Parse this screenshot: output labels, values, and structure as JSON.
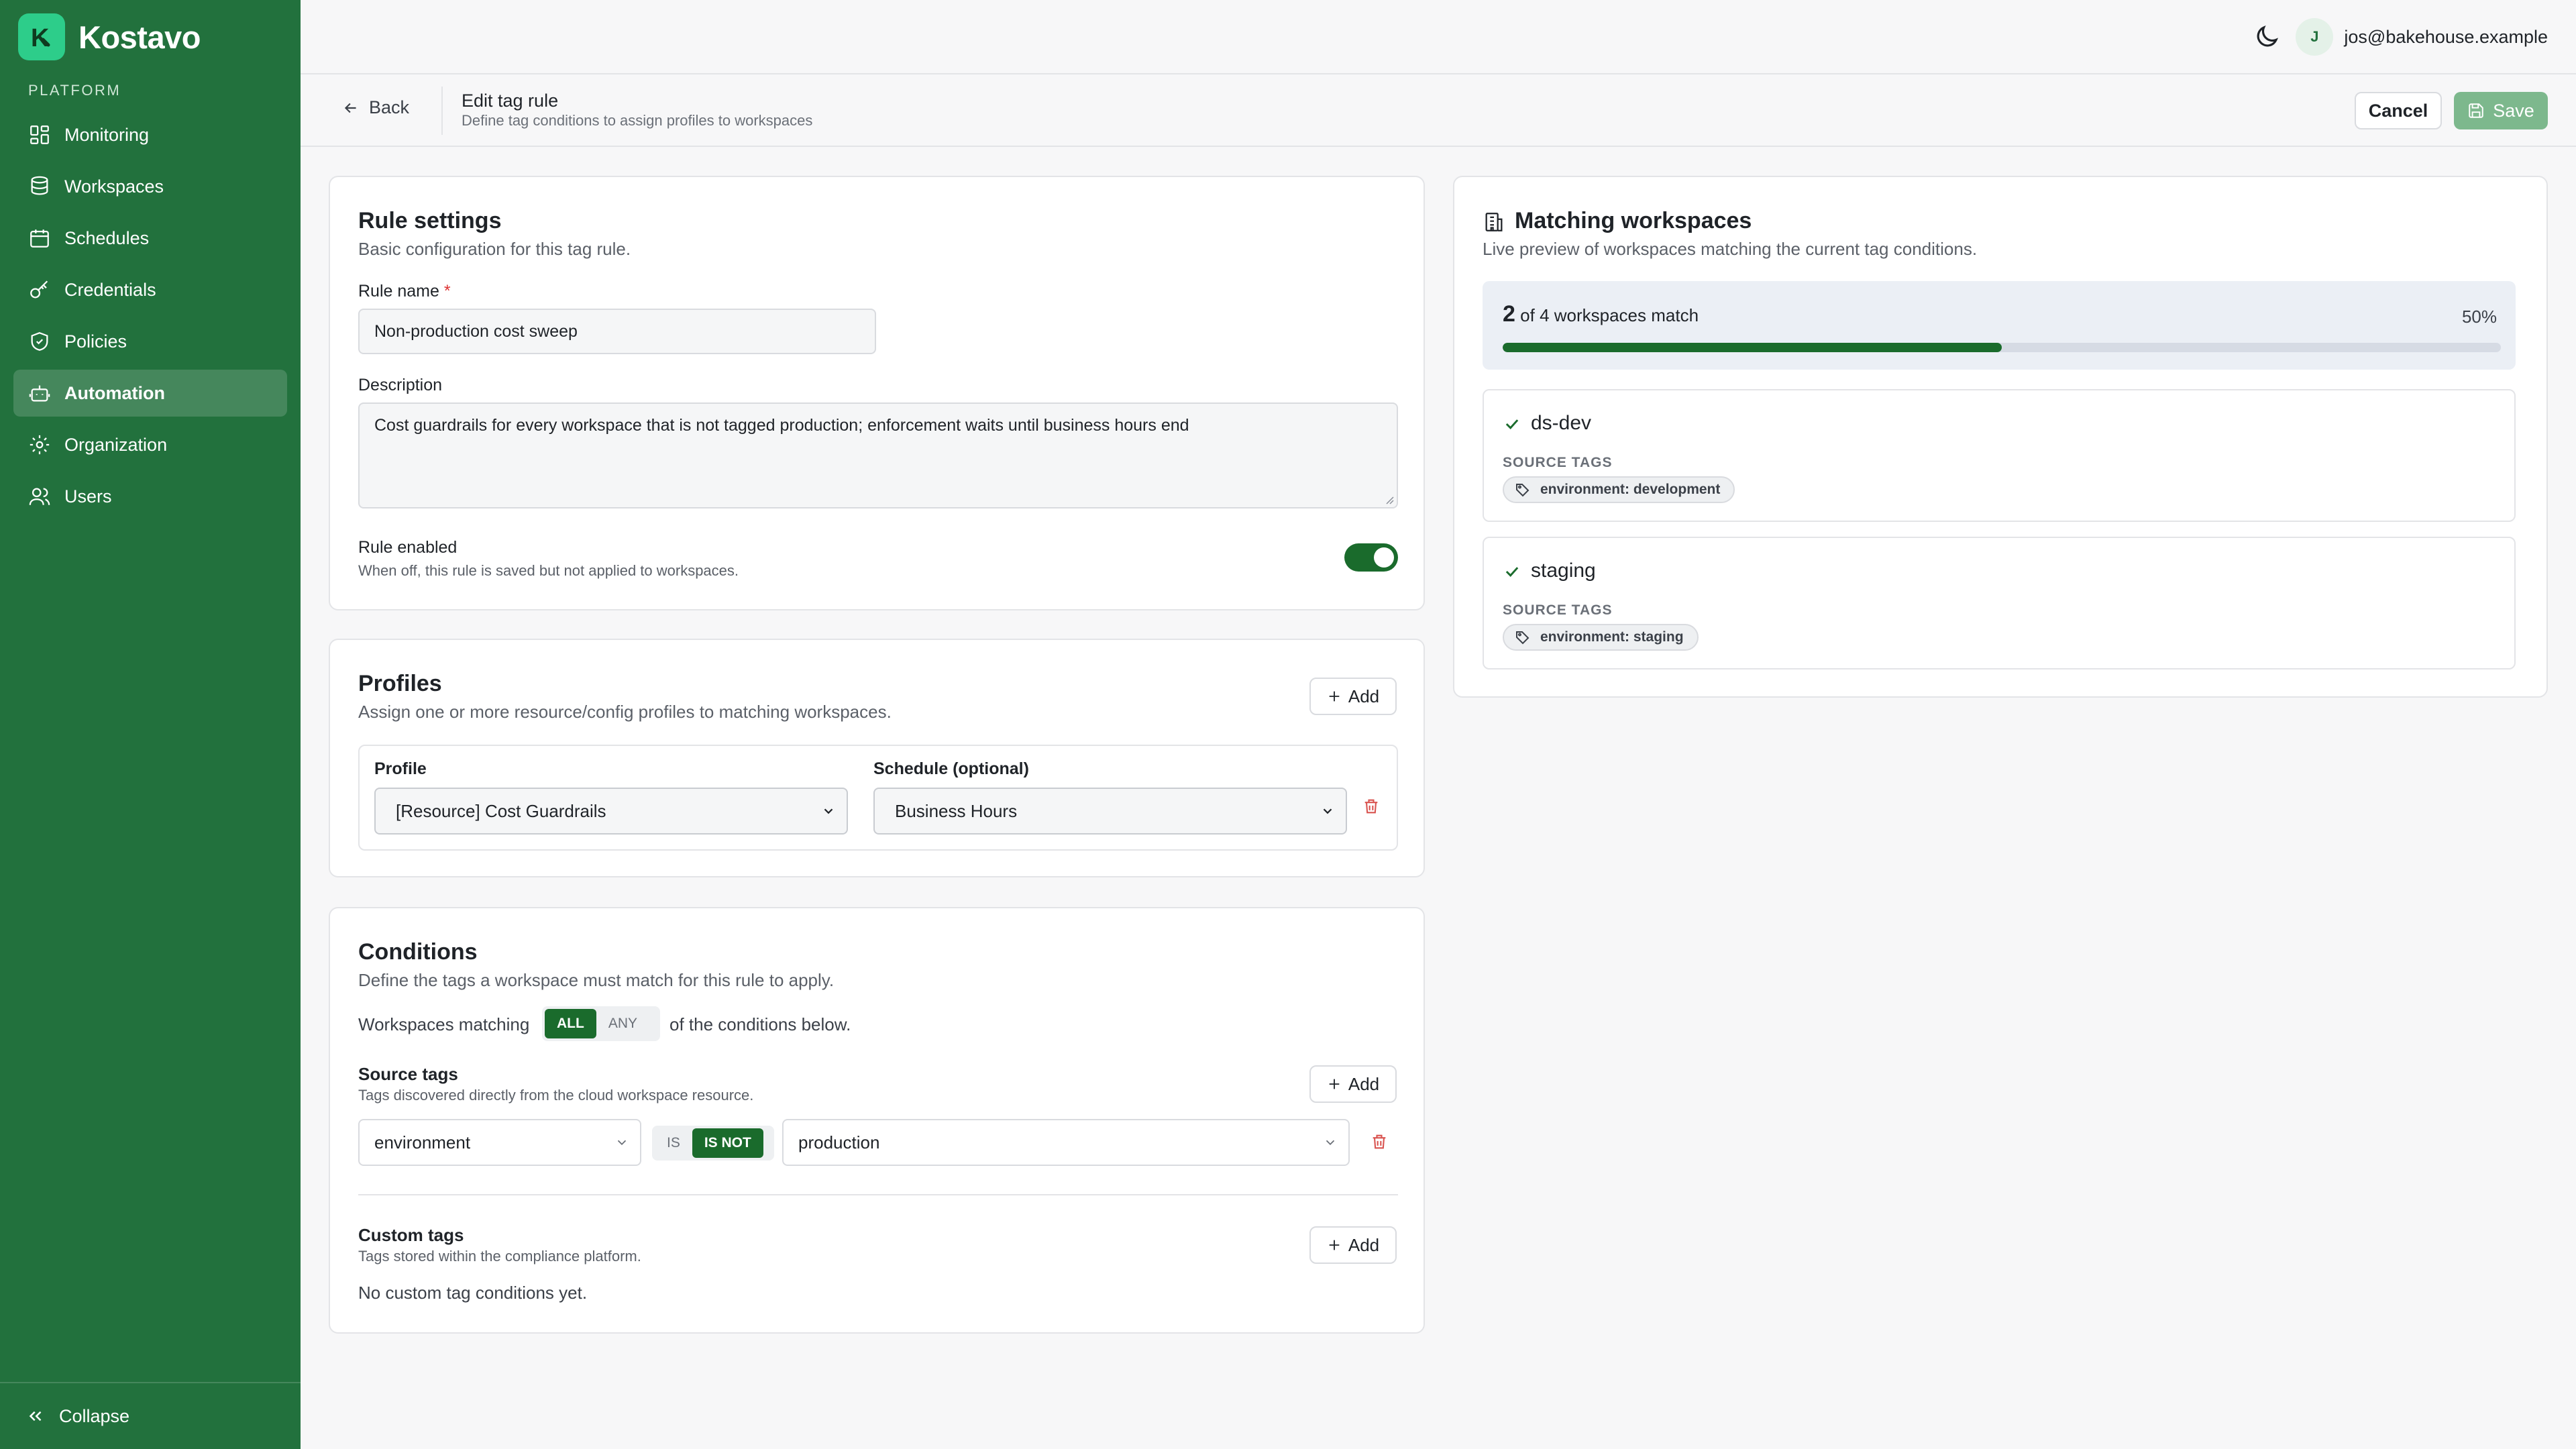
{
  "brand": {
    "logo_letter": "K",
    "name": "Kostavo"
  },
  "sidebar": {
    "section": "PLATFORM",
    "items": [
      {
        "label": "Monitoring",
        "icon": "dashboard-icon"
      },
      {
        "label": "Workspaces",
        "icon": "database-icon"
      },
      {
        "label": "Schedules",
        "icon": "calendar-icon"
      },
      {
        "label": "Credentials",
        "icon": "key-icon"
      },
      {
        "label": "Policies",
        "icon": "shield-icon"
      },
      {
        "label": "Automation",
        "icon": "bot-icon",
        "active": true
      },
      {
        "label": "Organization",
        "icon": "gear-icon"
      },
      {
        "label": "Users",
        "icon": "users-icon"
      }
    ],
    "collapse_label": "Collapse"
  },
  "topbar": {
    "user_initial": "J",
    "user_email": "jos@bakehouse.example"
  },
  "header": {
    "back_label": "Back",
    "title": "Edit tag rule",
    "subtitle": "Define tag conditions to assign profiles to workspaces",
    "cancel_label": "Cancel",
    "save_label": "Save"
  },
  "rule_settings": {
    "title": "Rule settings",
    "subtitle": "Basic configuration for this tag rule.",
    "name_label": "Rule name",
    "required_mark": "*",
    "name_value": "Non-production cost sweep",
    "description_label": "Description",
    "description_value": "Cost guardrails for every workspace that is not tagged production; enforcement waits until business hours end",
    "enabled_label": "Rule enabled",
    "enabled_hint": "When off, this rule is saved but not applied to workspaces.",
    "enabled": true
  },
  "profiles": {
    "title": "Profiles",
    "subtitle": "Assign one or more resource/config profiles to matching workspaces.",
    "add_label": "Add",
    "profile_label": "Profile",
    "schedule_label": "Schedule (optional)",
    "profile_value": "[Resource] Cost Guardrails",
    "schedule_value": "Business Hours"
  },
  "conditions": {
    "title": "Conditions",
    "subtitle": "Define the tags a workspace must match for this rule to apply.",
    "matching_prefix": "Workspaces matching",
    "match_all": "ALL",
    "match_any": "ANY",
    "matching_suffix": "of the conditions below.",
    "source_title": "Source tags",
    "source_hint": "Tags discovered directly from the cloud workspace resource.",
    "add_label": "Add",
    "source_key": "environment",
    "op_is": "IS",
    "op_is_not": "IS NOT",
    "source_value": "production",
    "custom_title": "Custom tags",
    "custom_hint": "Tags stored within the compliance platform.",
    "custom_empty": "No custom tag conditions yet."
  },
  "matching": {
    "title": "Matching workspaces",
    "subtitle": "Live preview of workspaces matching the current tag conditions.",
    "count": "2",
    "count_suffix": "of 4 workspaces match",
    "percent_label": "50%",
    "percent": 0.5,
    "source_tags_label": "SOURCE TAGS",
    "workspaces": [
      {
        "name": "ds-dev",
        "tag": "environment: development"
      },
      {
        "name": "staging",
        "tag": "environment: staging"
      }
    ]
  },
  "colors": {
    "sidebar": "#22713d",
    "accent": "#1a6b2c",
    "brand_logo": "#2dcd8a",
    "danger": "#d9534f"
  }
}
